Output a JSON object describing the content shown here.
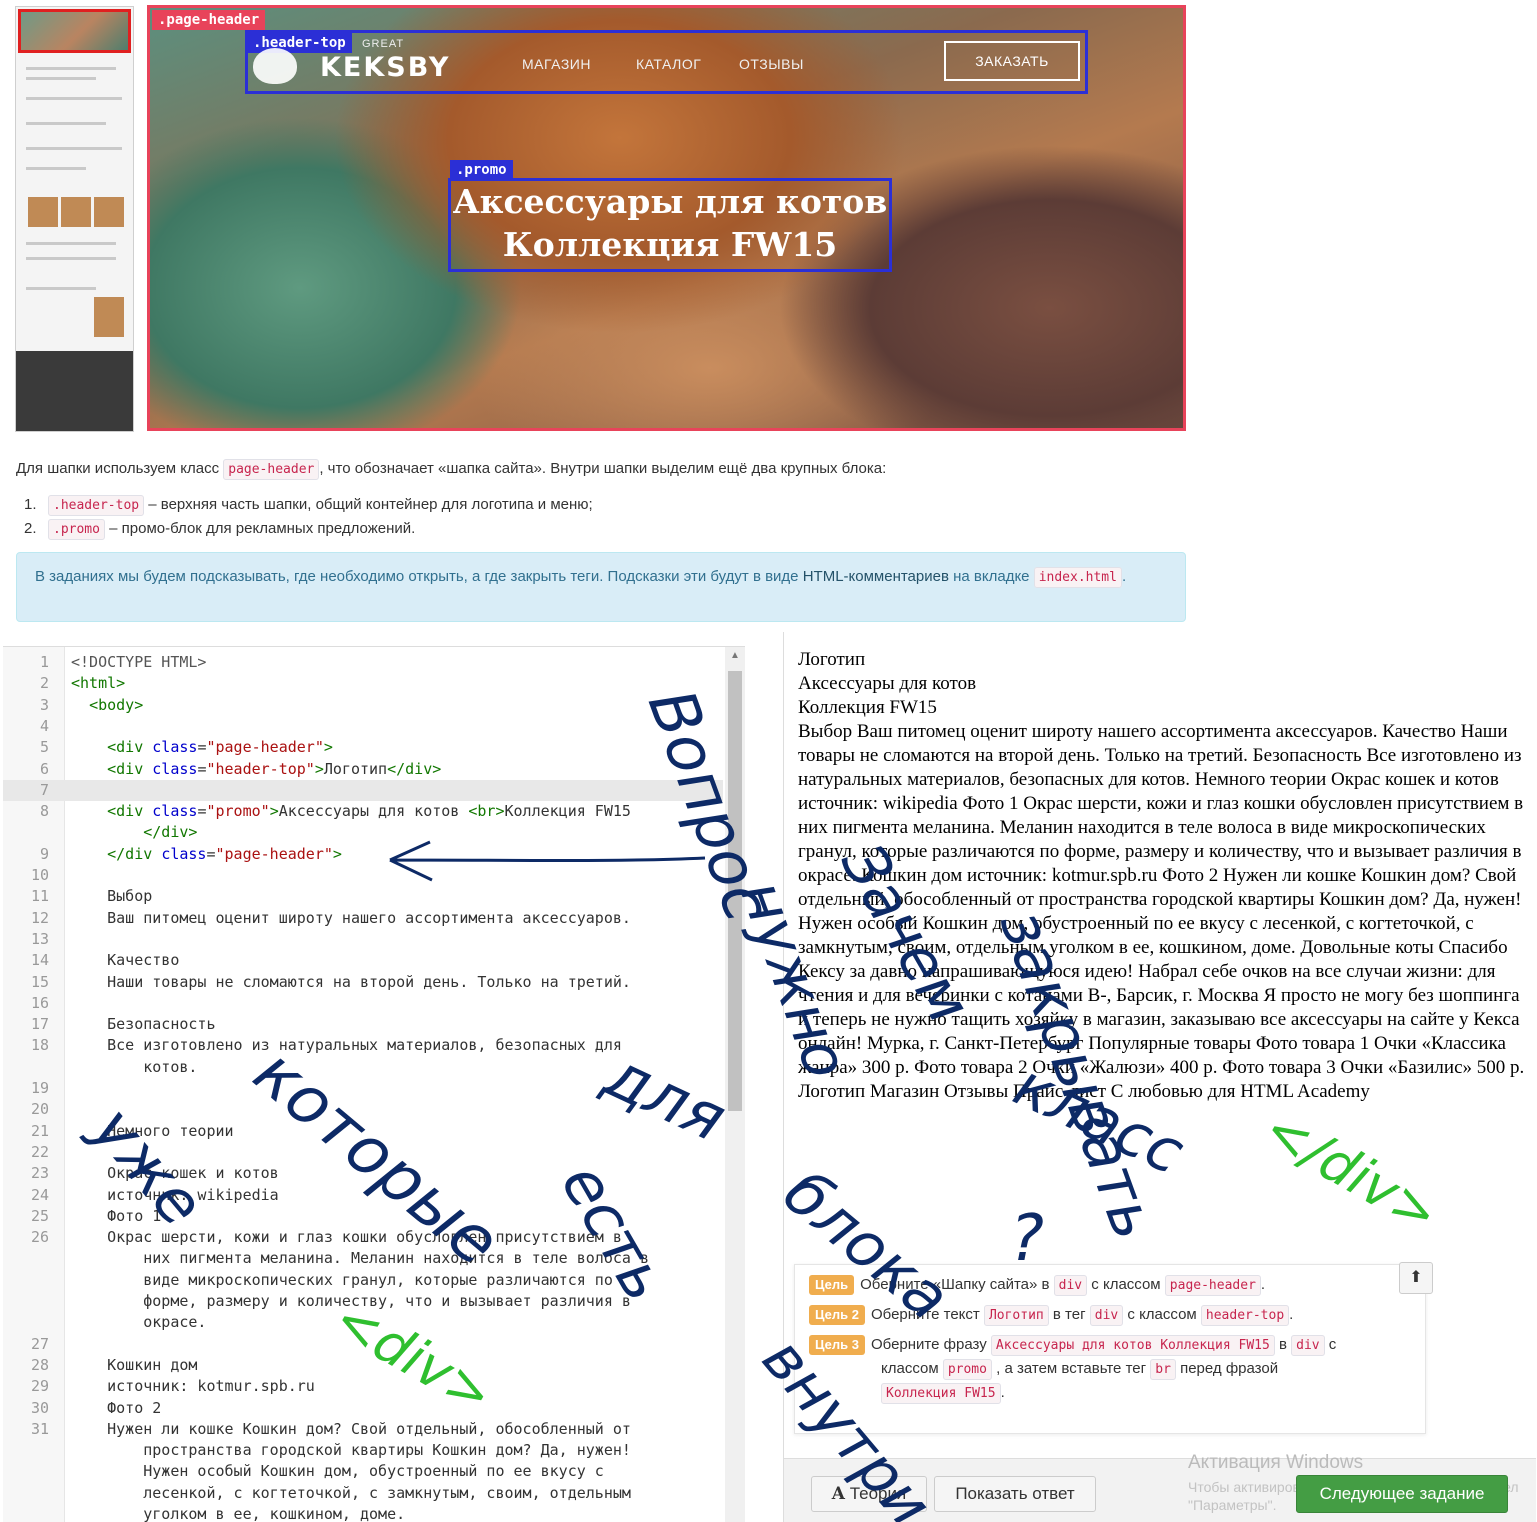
{
  "mockup": {
    "tags": {
      "page_header": ".page-header",
      "header_top": ".header-top",
      "promo": ".promo"
    },
    "logo_small": "GREAT",
    "logo_text": "KEKSBY",
    "nav": [
      "МАГАЗИН",
      "КАТАЛОГ",
      "ОТЗЫВЫ"
    ],
    "order_button": "ЗАКАЗАТЬ",
    "promo_line1": "Аксессуары для котов",
    "promo_line2": "Коллекция FW15"
  },
  "explanation": {
    "intro_before": "Для шапки используем класс ",
    "intro_code": "page-header",
    "intro_after": ", что обозначает «шапка сайта». Внутри шапки выделим ещё два крупных блока:",
    "items": [
      {
        "num": "1.",
        "code": ".header-top",
        "text": " – верхняя часть шапки, общий контейнер для логотипа и меню;"
      },
      {
        "num": "2.",
        "code": ".promo",
        "text": " – промо-блок для рекламных предложений."
      }
    ],
    "hint_before": "В заданиях мы будем подсказывать, где необходимо открыть, а где закрыть теги. Подсказки эти будут в виде ",
    "hint_link": "HTML-комментариев",
    "hint_middle": " на вкладке ",
    "hint_code": "index.html",
    "hint_after": "."
  },
  "editor": {
    "lines": [
      {
        "n": "1",
        "html": "<span class='cm-meta'>&lt;!DOCTYPE HTML&gt;</span>"
      },
      {
        "n": "2",
        "html": "<span class='cm-tag'>&lt;html&gt;</span>"
      },
      {
        "n": "3",
        "html": "  <span class='cm-tag'>&lt;body&gt;</span>"
      },
      {
        "n": "4",
        "html": ""
      },
      {
        "n": "5",
        "html": "    <span class='cm-tag'>&lt;div</span> <span class='cm-attr'>class</span>=<span class='cm-str'>\"page-header\"</span><span class='cm-tag'>&gt;</span>"
      },
      {
        "n": "6",
        "html": "    <span class='cm-tag'>&lt;div</span> <span class='cm-attr'>class</span>=<span class='cm-str'>\"header-top\"</span><span class='cm-tag'>&gt;</span>Логотип<span class='cm-tag'>&lt;/div&gt;</span>"
      },
      {
        "n": "7",
        "html": "",
        "active": true
      },
      {
        "n": "8",
        "html": "    <span class='cm-tag'>&lt;div</span> <span class='cm-attr'>class</span>=<span class='cm-str'>\"promo\"</span><span class='cm-tag'>&gt;</span>Аксессуары для котов <span class='cm-tag'>&lt;br&gt;</span>Коллекция FW15"
      },
      {
        "n": "",
        "html": "        <span class='cm-tag'>&lt;/div&gt;</span>"
      },
      {
        "n": "9",
        "html": "    <span class='cm-tag'>&lt;/div</span> <span class='cm-attr'>class</span>=<span class='cm-str'>\"page-header\"</span><span class='cm-tag'>&gt;</span>"
      },
      {
        "n": "10",
        "html": ""
      },
      {
        "n": "11",
        "html": "    Выбор"
      },
      {
        "n": "12",
        "html": "    Ваш питомец оценит широту нашего ассортимента аксессуаров."
      },
      {
        "n": "13",
        "html": ""
      },
      {
        "n": "14",
        "html": "    Качество"
      },
      {
        "n": "15",
        "html": "    Наши товары не сломаются на второй день. Только на третий."
      },
      {
        "n": "16",
        "html": ""
      },
      {
        "n": "17",
        "html": "    Безопасность"
      },
      {
        "n": "18",
        "html": "    Все изготовлено из натуральных материалов, безопасных для"
      },
      {
        "n": "",
        "html": "        котов."
      },
      {
        "n": "19",
        "html": ""
      },
      {
        "n": "20",
        "html": ""
      },
      {
        "n": "21",
        "html": "    Немного теории"
      },
      {
        "n": "22",
        "html": ""
      },
      {
        "n": "23",
        "html": "    Окрас кошек и котов"
      },
      {
        "n": "24",
        "html": "    источник: wikipedia"
      },
      {
        "n": "25",
        "html": "    Фото 1"
      },
      {
        "n": "26",
        "html": "    Окрас шерсти, кожи и глаз кошки обусловлен присутствием в"
      },
      {
        "n": "",
        "html": "        них пигмента меланина. Меланин находится в теле волоса в"
      },
      {
        "n": "",
        "html": "        виде микроскопических гранул, которые различаются по"
      },
      {
        "n": "",
        "html": "        форме, размеру и количеству, что и вызывает различия в"
      },
      {
        "n": "",
        "html": "        окрасе."
      },
      {
        "n": "27",
        "html": ""
      },
      {
        "n": "28",
        "html": "    Кошкин дом"
      },
      {
        "n": "29",
        "html": "    источник: kotmur.spb.ru"
      },
      {
        "n": "30",
        "html": "    Фото 2"
      },
      {
        "n": "31",
        "html": "    Нужен ли кошке Кошкин дом? Свой отдельный, обособленный от"
      },
      {
        "n": "",
        "html": "        пространства городской квартиры Кошкин дом? Да, нужен!"
      },
      {
        "n": "",
        "html": "        Нужен особый Кошкин дом, обустроенный по ее вкусу с"
      },
      {
        "n": "",
        "html": "        лесенкой, с когтеточкой, с замкнутым, своим, отдельным"
      },
      {
        "n": "",
        "html": "        уголком в ее, кошкином, доме."
      }
    ]
  },
  "preview": {
    "lines": [
      "Логотип",
      "Аксессуары для котов",
      "Коллекция FW15",
      "Выбор Ваш питомец оценит широту нашего ассортимента аксессуаров. Качество Наши товары не сломаются на второй день. Только на третий. Безопасность Все изготовлено из натуральных материалов, безопасных для котов. Немного теории Окрас кошек и котов источник: wikipedia Фото 1 Окрас шерсти, кожи и глаз кошки обусловлен присутствием в них пигмента меланина. Меланин находится в теле волоса в виде микроскопических гранул, которые различаются по форме, размеру и количеству, что и вызывает различия в окрасе. Кошкин дом источник: kotmur.spb.ru Фото 2 Нужен ли кошке Кошкин дом? Свой отдельный, обособленный от пространства городской квартиры Кошкин дом? Да, нужен! Нужен особый Кошкин дом, обустроенный по ее вкусу с лесенкой, с когтеточкой, с замкнутым, своим, отдельным уголком в ее, кошкином, доме. Довольные коты Спасибо Кексу за давно напрашивающуюся идею! Набрал себе очков на все случаи жизни: для чтения и для вечеринки с котанами В-, Барсик, г. Москва Я просто не могу без шоппинга и теперь не нужно тащить хозяйку в магазин, заказываю все аксессуары на сайте у Кекса онлайн! Мурка, г. Санкт-Петербург Популярные товары Фото товара 1 Очки «Классика жанра» 300 р. Фото товара 2 Очки «Жалюзи» 400 р. Фото товара 3 Очки «Базилис» 500 р. Логотип Магазин Отзывы Прайс-лист С любовью для HTML Academy"
    ],
    "tasks": [
      {
        "badge": "Цель",
        "html": "Оберните «Шапку сайта» в <code class='inl'>div</code> с классом <code class='inl'>page-header</code>."
      },
      {
        "badge": "Цель 2",
        "html": "Оберните текст <code class='inl'>Логотип</code> в тег <code class='inl'>div</code> с классом <code class='inl'>header-top</code>."
      },
      {
        "badge": "Цель 3",
        "html": "Оберните фразу <code class='inl'>Аксессуары для котов Коллекция FW15</code> в <code class='inl'>div</code> с"
      },
      {
        "badge": "",
        "html": "классом <code class='inl'>promo</code> , а затем вставьте тег <code class='inl'>br</code> перед фразой"
      },
      {
        "badge": "",
        "html": "<code class='inl'>Коллекция FW15</code>."
      }
    ],
    "up_icon": "⬆",
    "theory_button": "Теория",
    "theory_icon": "A",
    "show_answer_button": "Показать ответ",
    "next_button": "Следующее задание",
    "watermark_title": "Активация Windows",
    "watermark_sub1": "Чтобы активировать Windows, перейдите в раздел",
    "watermark_sub2": "\"Параметры\"."
  },
  "handwriting": {
    "blue": [
      "Вопрос",
      "Зачем",
      "нужно",
      "закрывать",
      "класс",
      "для",
      "блока",
      "которые",
      "уже",
      "есть",
      "внутри",
      "?"
    ],
    "green": [
      "<div>",
      "</div>"
    ]
  },
  "colors": {
    "page_header_outline": "#e8435a",
    "inner_outline": "#2b2fd6",
    "hint_bg": "#d9edf7",
    "goal_badge": "#f0ad4e",
    "next_button": "#449d44",
    "ink_blue": "#0d2a66",
    "ink_green": "#2fbf2f"
  }
}
